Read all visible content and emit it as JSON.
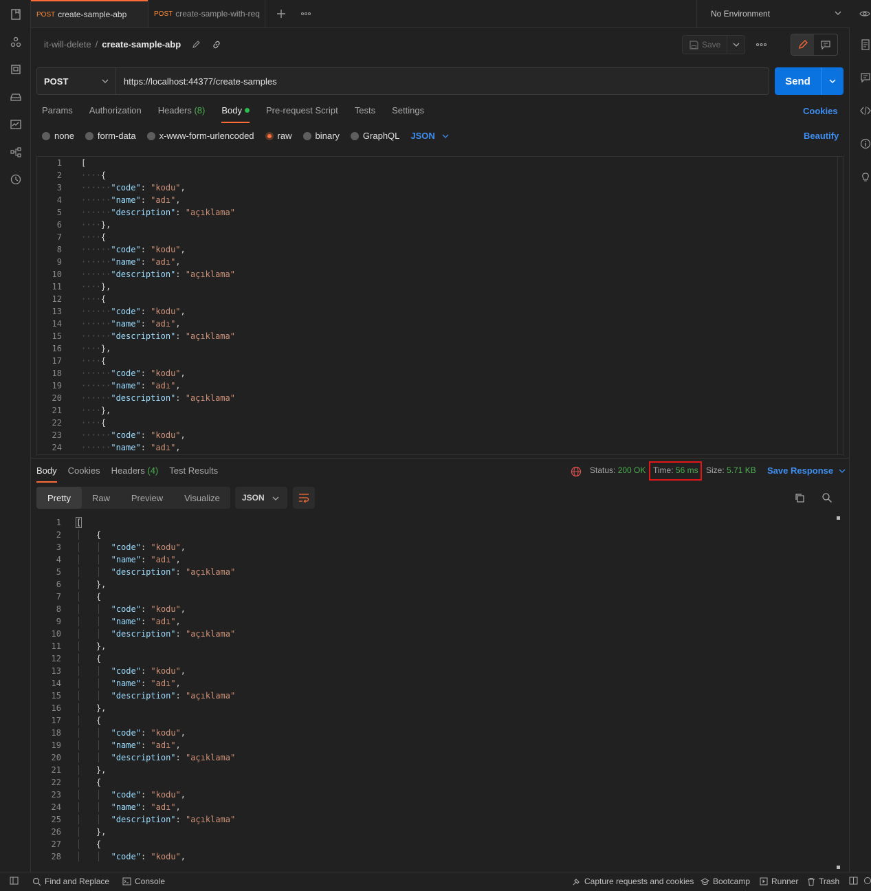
{
  "tabs": [
    {
      "method": "POST",
      "name": "create-sample-abp",
      "active": true
    },
    {
      "method": "POST",
      "name": "create-sample-with-req",
      "active": false
    }
  ],
  "environment": {
    "label": "No Environment"
  },
  "breadcrumb": {
    "parent": "it-will-delete",
    "separator": "/",
    "current": "create-sample-abp"
  },
  "toolbar": {
    "save_label": "Save"
  },
  "request": {
    "method": "POST",
    "url": "https://localhost:44377/create-samples",
    "send_label": "Send"
  },
  "request_tabs": {
    "params": "Params",
    "authorization": "Authorization",
    "headers": "Headers",
    "headers_count": "(8)",
    "body": "Body",
    "prerequest": "Pre-request Script",
    "tests": "Tests",
    "settings": "Settings",
    "cookies": "Cookies"
  },
  "body_types": {
    "none": "none",
    "form_data": "form-data",
    "urlencoded": "x-www-form-urlencoded",
    "raw": "raw",
    "binary": "binary",
    "graphql": "GraphQL",
    "language": "JSON",
    "beautify": "Beautify"
  },
  "sample_item": {
    "code": "kodu",
    "name": "adı",
    "description": "açıklama"
  },
  "request_body_lines": 24,
  "response_lines": 28,
  "response_tabs": {
    "body": "Body",
    "cookies": "Cookies",
    "headers": "Headers",
    "headers_count": "(4)",
    "test_results": "Test Results"
  },
  "response_meta": {
    "status_label": "Status:",
    "status": "200 OK",
    "time_label": "Time:",
    "time": "56 ms",
    "size_label": "Size:",
    "size": "5.71 KB",
    "save_response": "Save Response"
  },
  "response_views": {
    "pretty": "Pretty",
    "raw": "Raw",
    "preview": "Preview",
    "visualize": "Visualize",
    "format": "JSON"
  },
  "footer": {
    "find_replace": "Find and Replace",
    "console": "Console",
    "capture": "Capture requests and cookies",
    "bootcamp": "Bootcamp",
    "runner": "Runner",
    "trash": "Trash"
  },
  "colors": {
    "accent": "#ff6c37",
    "primary": "#0b73e0",
    "success": "#4caf50",
    "highlight": "#e3161a"
  }
}
